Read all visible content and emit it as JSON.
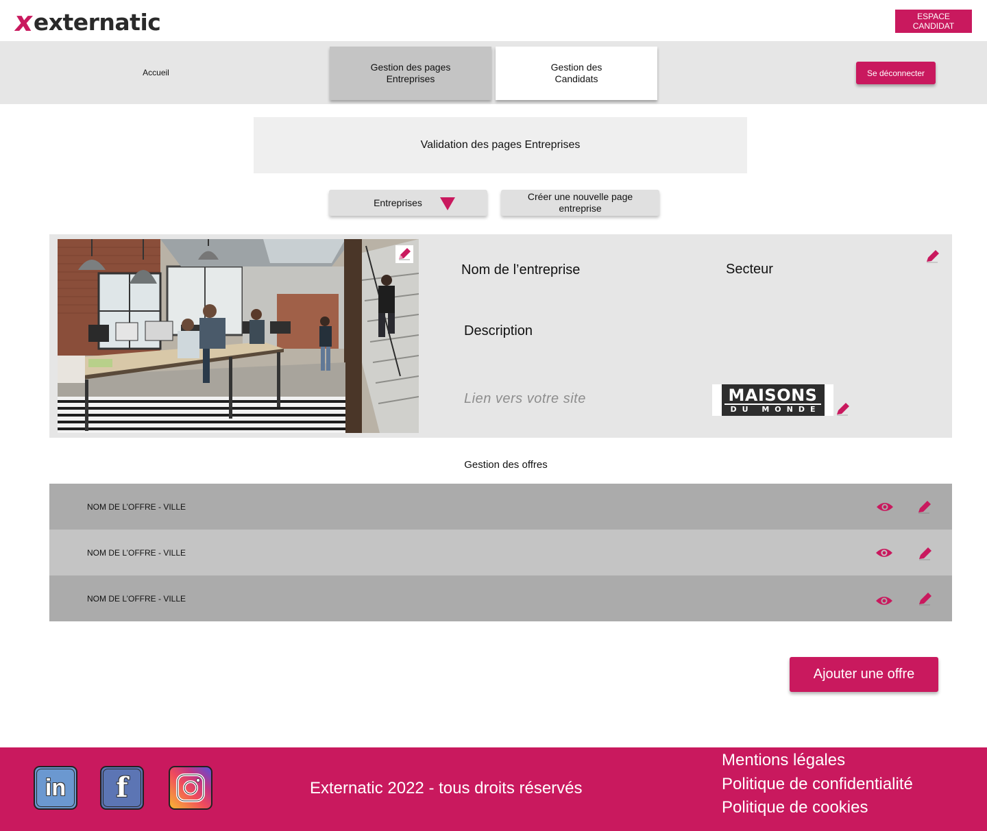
{
  "header": {
    "logo_mark": "x",
    "logo_text": "externatic",
    "espace_btn": "ESPACE CANDIDAT"
  },
  "nav": {
    "home": "Accueil",
    "tab_entreprises": "Gestion des pages Entreprises",
    "tab_candidats": "Gestion des Candidats",
    "logout": "Se déconnecter"
  },
  "main": {
    "title": "Validation des pages Entreprises",
    "dropdown_label": "Entreprises",
    "create_label": "Créer une nouvelle page entreprise"
  },
  "company": {
    "name_label": "Nom de l’entreprise",
    "sector_label": "Secteur",
    "description_label": "Description",
    "link_placeholder": "Lien vers votre site",
    "brand_top": "MAISONS",
    "brand_bottom": "DU MONDE"
  },
  "offers": {
    "title": "Gestion des offres",
    "items": [
      {
        "label": "NOM DE L’OFFRE - VILLE"
      },
      {
        "label": "NOM DE L’OFFRE - VILLE"
      },
      {
        "label": "NOM DE L’OFFRE - VILLE"
      }
    ],
    "add_label": "Ajouter une offre"
  },
  "footer": {
    "copyright": "Externatic 2022 - tous droits réservés",
    "links": [
      "Mentions légales",
      "Politique de confidentialité",
      "Politique de cookies"
    ],
    "social": {
      "linkedin": "in",
      "facebook": "f"
    }
  },
  "icons": [
    "pencil-icon",
    "eye-icon",
    "dropdown-triangle-icon",
    "linkedin-icon",
    "facebook-icon",
    "instagram-icon"
  ],
  "colors": {
    "accent": "#c9195e",
    "navbar": "#e6e6e6",
    "row_dark": "#ababab",
    "row_light": "#c4c4c4"
  }
}
